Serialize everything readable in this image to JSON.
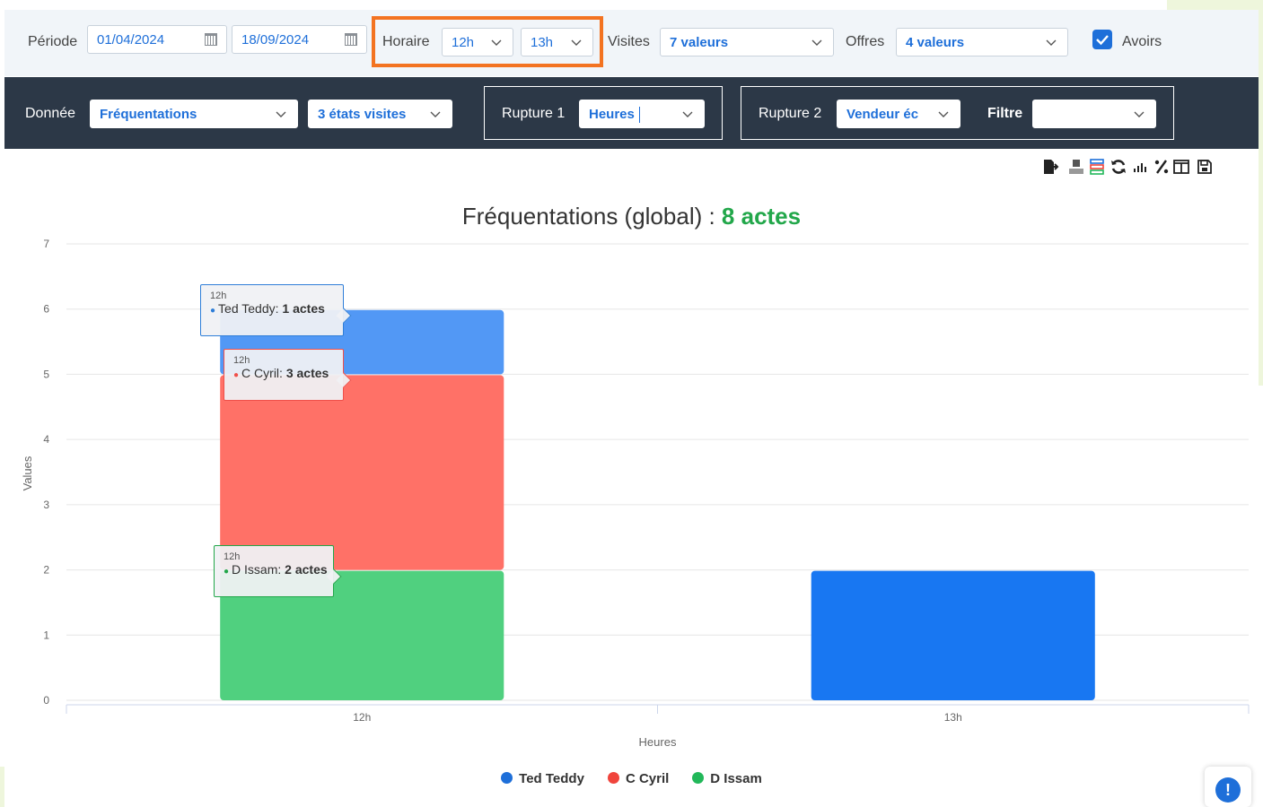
{
  "filters": {
    "periode_label": "Période",
    "date_from": "01/04/2024",
    "date_to": "18/09/2024",
    "horaire_label": "Horaire",
    "horaire_from": "12h",
    "horaire_to": "13h",
    "visites_label": "Visites",
    "visites_value": "7 valeurs",
    "offres_label": "Offres",
    "offres_value": "4 valeurs",
    "avoirs_label": "Avoirs",
    "avoirs_checked": true
  },
  "config": {
    "donnee_label": "Donnée",
    "donnee_value": "Fréquentations",
    "etats_value": "3 états visites",
    "rupture1_label": "Rupture 1",
    "rupture1_value": "Heures",
    "rupture2_label": "Rupture 2",
    "rupture2_value": "Vendeur éc",
    "filtre_label": "Filtre",
    "filtre_value": ""
  },
  "toolbar": {
    "icons": [
      "export-icon",
      "number-format-icon",
      "stack-icon",
      "refresh-icon",
      "bar-chart-icon",
      "percent-icon",
      "columns-icon",
      "save-icon"
    ]
  },
  "chart_title": {
    "prefix": "Fréquentations (global) : ",
    "highlight": "8 actes"
  },
  "chart_data": {
    "type": "bar",
    "stacked": true,
    "categories": [
      "12h",
      "13h"
    ],
    "series": [
      {
        "name": "Ted Teddy",
        "color": "#5298f5",
        "values": [
          1,
          2
        ]
      },
      {
        "name": "C Cyril",
        "color": "#ff7167",
        "values": [
          3,
          0
        ]
      },
      {
        "name": "D Issam",
        "color": "#50d07f",
        "values": [
          2,
          0
        ]
      }
    ],
    "xlabel": "Heures",
    "ylabel": "Values",
    "ylim": [
      0,
      7
    ],
    "yticks": [
      0,
      1,
      2,
      3,
      4,
      5,
      6,
      7
    ],
    "grid": true,
    "legend": "bottom"
  },
  "tooltips": [
    {
      "title": "12h",
      "name": "Ted Teddy",
      "sep": ": ",
      "value": "1 actes",
      "color": "#2f7ed8"
    },
    {
      "title": "12h",
      "name": "C Cyril",
      "sep": ": ",
      "value": "3 actes",
      "color": "#f0504a"
    },
    {
      "title": "12h",
      "name": "D Issam",
      "sep": ": ",
      "value": "2 actes",
      "color": "#22a74a"
    }
  ],
  "legend": [
    {
      "name": "Ted Teddy",
      "color": "#1e6fd9"
    },
    {
      "name": "C Cyril",
      "color": "#f0443c"
    },
    {
      "name": "D Issam",
      "color": "#22b85a"
    }
  ],
  "help_button": {
    "symbol": "!"
  }
}
